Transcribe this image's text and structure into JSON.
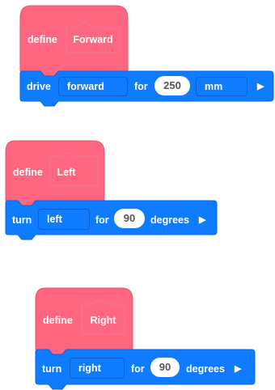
{
  "colors": {
    "define_block": "#ff6680",
    "motion_block": "#0f7bff",
    "input_background": "#ffffff"
  },
  "scripts": [
    {
      "define": {
        "keyword": "define",
        "name": "Forward"
      },
      "command": {
        "verb": "drive",
        "direction": "forward",
        "for_label": "for",
        "value": "250",
        "unit": "mm",
        "run_icon": "play-triangle-icon",
        "run_glyph": "▶"
      }
    },
    {
      "define": {
        "keyword": "define",
        "name": "Left"
      },
      "command": {
        "verb": "turn",
        "direction": "left",
        "for_label": "for",
        "value": "90",
        "unit": "degrees",
        "run_icon": "play-triangle-icon",
        "run_glyph": "▶"
      }
    },
    {
      "define": {
        "keyword": "define",
        "name": "Right"
      },
      "command": {
        "verb": "turn",
        "direction": "right",
        "for_label": "for",
        "value": "90",
        "unit": "degrees",
        "run_icon": "play-triangle-icon",
        "run_glyph": "▶"
      }
    }
  ]
}
